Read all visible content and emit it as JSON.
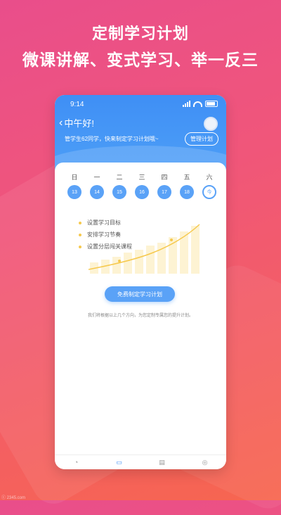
{
  "promo": {
    "title": "定制学习计划",
    "subtitle": "微课讲解、变式学习、举一反三"
  },
  "phone": {
    "time": "9:14",
    "greeting": "中午好!",
    "info": "管学生62同学，快来制定学习计划哦~",
    "manage_button": "管理计划",
    "weekdays": [
      "日",
      "一",
      "二",
      "三",
      "四",
      "五",
      "六"
    ],
    "dates": [
      "13",
      "14",
      "15",
      "16",
      "17",
      "18",
      "今"
    ],
    "items": [
      "设置学习目标",
      "安排学习节奏",
      "设置分层闯关课程"
    ],
    "cta": "免费制定学习计划",
    "note": "我们将根据以上几个方向，为您定制专属您的提升计划。",
    "tabs": [
      "chart-icon",
      "book-icon",
      "notes-icon",
      "profile-icon"
    ]
  },
  "watermark": "ⓒ 2345.com",
  "colors": {
    "accent": "#3f8ff5",
    "date_bg": "#5aa2f7",
    "bullet": "#f6c94e"
  }
}
